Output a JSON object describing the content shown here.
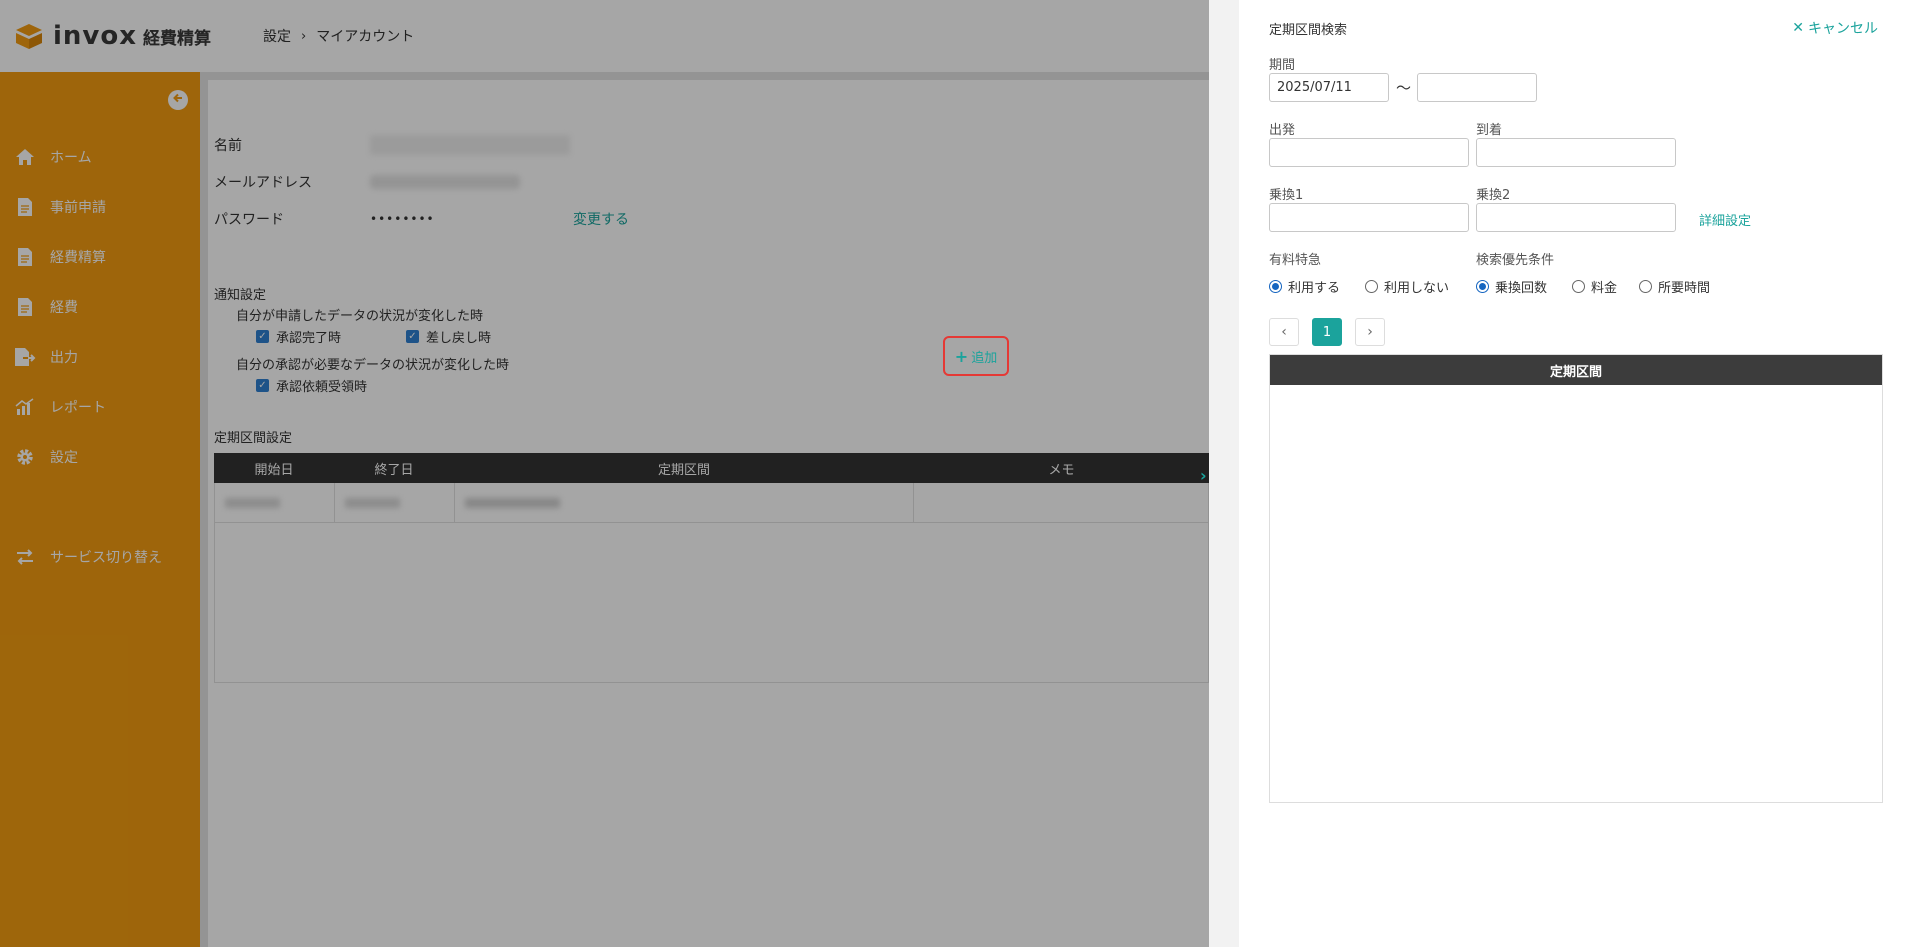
{
  "app": {
    "logo_text": "invox",
    "logo_sub": "経費精算"
  },
  "breadcrumb": {
    "items": [
      "設定",
      "マイアカウント"
    ],
    "separator": "›"
  },
  "sidebar": {
    "accent_color": "#f39c11",
    "items": [
      {
        "label": "ホーム",
        "icon": "home-icon"
      },
      {
        "label": "事前申請",
        "icon": "document-icon"
      },
      {
        "label": "経費精算",
        "icon": "document-icon"
      },
      {
        "label": "経費",
        "icon": "document-icon"
      },
      {
        "label": "出力",
        "icon": "export-icon"
      },
      {
        "label": "レポート",
        "icon": "chart-icon"
      },
      {
        "label": "設定",
        "icon": "gear-icon"
      },
      {
        "label": "サービス切り替え",
        "icon": "switch-icon"
      }
    ]
  },
  "account": {
    "name_label": "名前",
    "name_value": "",
    "email_label": "メールアドレス",
    "email_value": "",
    "password_label": "パスワード",
    "password_value": "••••••••",
    "change_link": "変更する"
  },
  "notifications": {
    "title": "通知設定",
    "group1_title": "自分が申請したデータの状況が変化した時",
    "approved_label": "承認完了時",
    "returned_label": "差し戻し時",
    "group2_title": "自分の承認が必要なデータの状況が変化した時",
    "request_label": "承認依頼受領時"
  },
  "commute": {
    "title": "定期区間設定",
    "add_label": "追加",
    "columns": [
      "開始日",
      "終了日",
      "定期区間",
      "メモ"
    ],
    "rows": [
      {
        "start": "",
        "end": "",
        "route": "",
        "memo": ""
      }
    ]
  },
  "search_panel": {
    "title": "定期区間検索",
    "cancel_label": "キャンセル",
    "period_label": "期間",
    "period_from": "2025/07/11",
    "period_to": "",
    "tilde": "〜",
    "departure_label": "出発",
    "arrival_label": "到着",
    "transfer1_label": "乗換1",
    "transfer2_label": "乗換2",
    "detail_link": "詳細設定",
    "express_label": "有料特急",
    "express_options": [
      {
        "label": "利用する",
        "selected": true
      },
      {
        "label": "利用しない",
        "selected": false
      }
    ],
    "priority_label": "検索優先条件",
    "priority_options": [
      {
        "label": "乗換回数",
        "selected": true
      },
      {
        "label": "料金",
        "selected": false
      },
      {
        "label": "所要時間",
        "selected": false
      }
    ],
    "pager": {
      "prev": "‹",
      "current": "1",
      "next": "›"
    },
    "result_header": "定期区間",
    "accent_color": "#1ba39c"
  }
}
